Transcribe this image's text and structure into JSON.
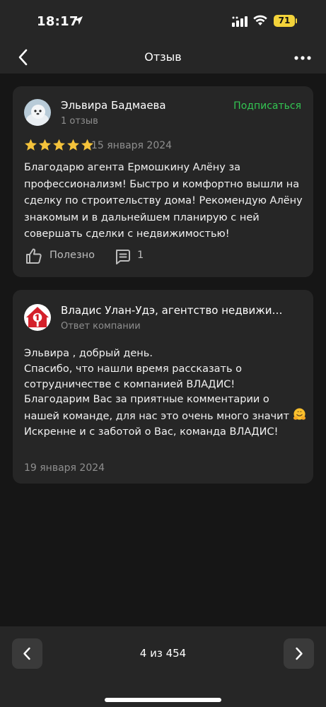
{
  "status_bar": {
    "time": "18:17",
    "battery": "71"
  },
  "nav": {
    "title": "Отзыв",
    "back_icon": "chevron-left-icon",
    "more_icon": "more-horizontal-icon"
  },
  "review": {
    "author": "Эльвира Бадмаева",
    "review_count": "1 отзыв",
    "subscribe_label": "Подписаться",
    "rating": 5,
    "date": "15 января 2024",
    "text": "Благодарю агента Ермошкину Алёну за профессионализм! Быстро и комфортно вышли на сделку по строительству дома! Рекомендую Алёну знакомым и в дальнейшем планирую с ней совершать сделки с недвижимостью!",
    "useful_label": "Полезно",
    "comment_count": "1"
  },
  "reply": {
    "author": "Владис Улан-Удэ, агентство недвижимости",
    "role": "Ответ компании",
    "greeting": "Эльвира , добрый день.",
    "line1": "Спасибо, что нашли время рассказать о сотрудничестве с компанией ВЛАДИС!",
    "line2": "Благодарим Вас за приятные комментарии о нашей команде, для нас это очень много значит",
    "line3": "Искренне и с заботой о Вас, команда ВЛАДИС!",
    "date": "19 января 2024"
  },
  "pagination": {
    "counter": "4 из 454"
  },
  "colors": {
    "accent_green": "#33c552",
    "star": "#f5c33b",
    "card": "#262626",
    "background": "#161616"
  }
}
